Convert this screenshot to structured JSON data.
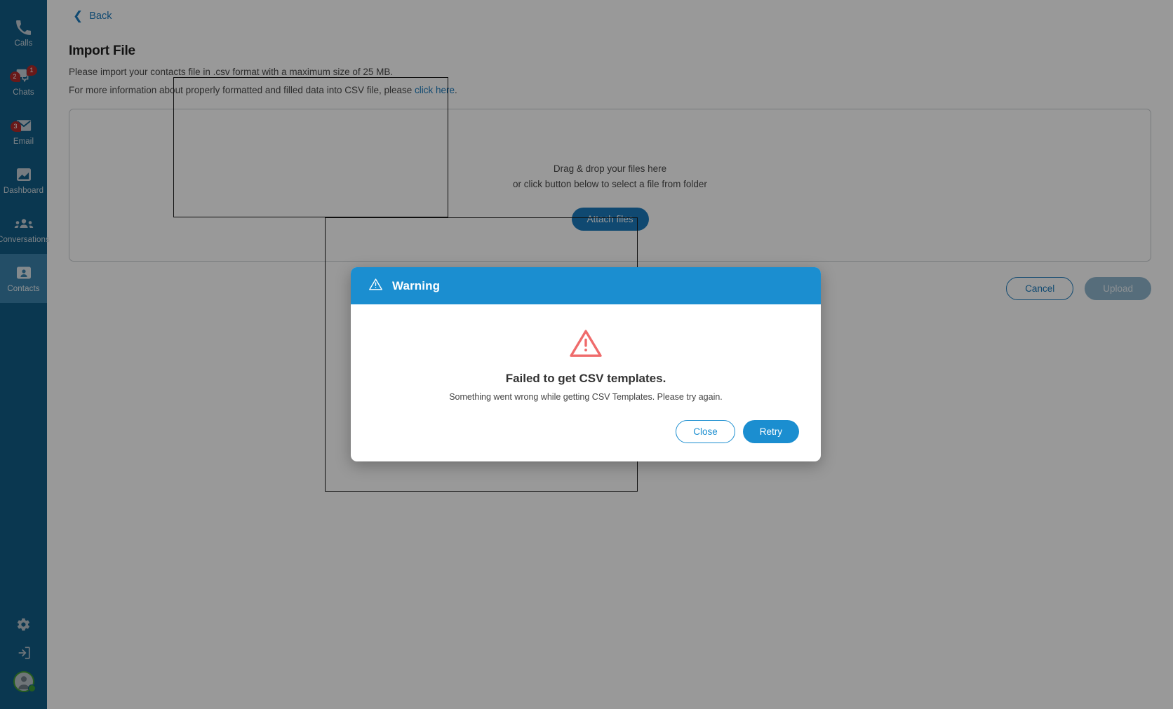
{
  "sidebar": {
    "items": [
      {
        "label": "Calls",
        "icon": "phone-icon",
        "badges": [],
        "active": false
      },
      {
        "label": "Chats",
        "icon": "chat-icon",
        "badges": [
          "1",
          "2"
        ],
        "active": false
      },
      {
        "label": "Email",
        "icon": "envelope-icon",
        "badges": [
          "3"
        ],
        "active": false
      },
      {
        "label": "Dashboard",
        "icon": "dashboard-icon",
        "badges": [],
        "active": false
      },
      {
        "label": "Conversations",
        "icon": "people-icon",
        "badges": [],
        "active": false
      },
      {
        "label": "Contacts",
        "icon": "contact-card-icon",
        "badges": [],
        "active": true
      }
    ],
    "bottom": [
      {
        "icon": "gear-icon"
      },
      {
        "icon": "logout-icon"
      }
    ],
    "avatar": {
      "icon": "user-avatar-icon",
      "status": "online"
    },
    "background_color": "#115c86",
    "active_color": "#3b83ac"
  },
  "page": {
    "back_label": "Back",
    "title": "Import File",
    "subtitle_1": "Please import your contacts file in .csv format with a maximum size of 25 MB.",
    "subtitle_2_prefix": "For more information about properly formatted and filled data into CSV file, please ",
    "subtitle_2_link": "click here",
    "subtitle_2_suffix": ".",
    "dropzone": {
      "line_1": "Drag & drop your files here",
      "line_2": "or click button below to select a file from folder",
      "attach_label": "Attach files"
    },
    "actions": {
      "cancel_label": "Cancel",
      "upload_label": "Upload"
    },
    "link_color": "#1b7bbd",
    "primary_color": "#1b7bbd"
  },
  "modal": {
    "header_title": "Warning",
    "header_icon": "warning-triangle-icon",
    "body_icon": "warning-triangle-icon",
    "title": "Failed to get CSV templates.",
    "message": "Something went wrong while getting CSV Templates. Please try again.",
    "close_label": "Close",
    "retry_label": "Retry",
    "header_color": "#1b8ed0",
    "accent_color": "#1b8ed0",
    "warning_color": "#ef6b6b"
  }
}
